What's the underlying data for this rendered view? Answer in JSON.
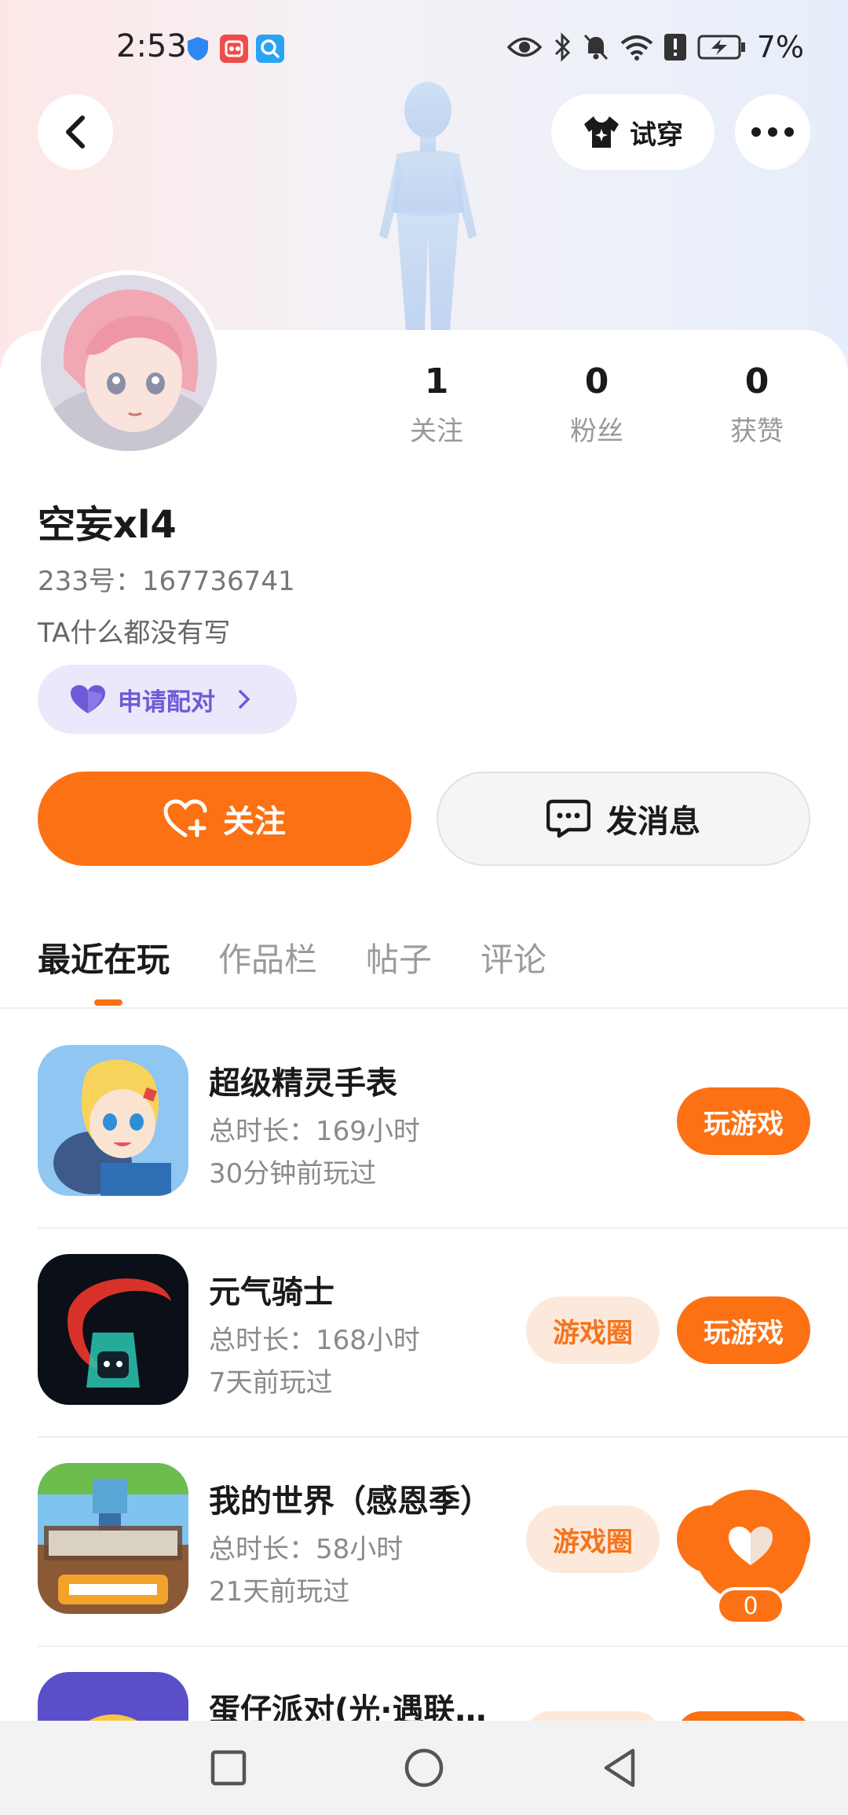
{
  "status_bar": {
    "time": "2:53",
    "battery": "7%",
    "icons": [
      "shield-icon",
      "app-icon",
      "search-app-icon",
      "eye-icon",
      "bluetooth-icon",
      "mute-icon",
      "wifi-icon",
      "alert-icon",
      "battery-icon"
    ]
  },
  "header": {
    "tryon_label": "试穿",
    "back_icon": "chevron-left-icon",
    "more_icon": "more-icon"
  },
  "profile": {
    "stats": [
      {
        "value": "1",
        "label": "关注"
      },
      {
        "value": "0",
        "label": "粉丝"
      },
      {
        "value": "0",
        "label": "获赞"
      }
    ],
    "username": "空妄xl4",
    "uid": "233号：167736741",
    "bio": "TA什么都没有写",
    "pair_label": "申请配对"
  },
  "actions": {
    "follow_label": "关注",
    "message_label": "发消息"
  },
  "tabs": [
    "最近在玩",
    "作品栏",
    "帖子",
    "评论"
  ],
  "games": [
    {
      "name": "超级精灵手表",
      "duration": "总时长：169小时",
      "last_played": "30分钟前玩过",
      "play_label": "玩游戏",
      "circle_label": ""
    },
    {
      "name": "元气骑士",
      "duration": "总时长：168小时",
      "last_played": "7天前玩过",
      "play_label": "玩游戏",
      "circle_label": "游戏圈"
    },
    {
      "name": "我的世界（感恩季）",
      "duration": "总时长：58小时",
      "last_played": "21天前玩过",
      "play_label": "玩游戏",
      "circle_label": "游戏圈"
    },
    {
      "name": "蛋仔派对(光·遇联…",
      "duration": "",
      "last_played": "",
      "play_label": "",
      "circle_label": ""
    }
  ],
  "float_like": {
    "count": "0"
  },
  "colors": {
    "accent": "#fb7114",
    "pair_bg": "#ebe8fb",
    "pair_text": "#6e5ad8"
  }
}
